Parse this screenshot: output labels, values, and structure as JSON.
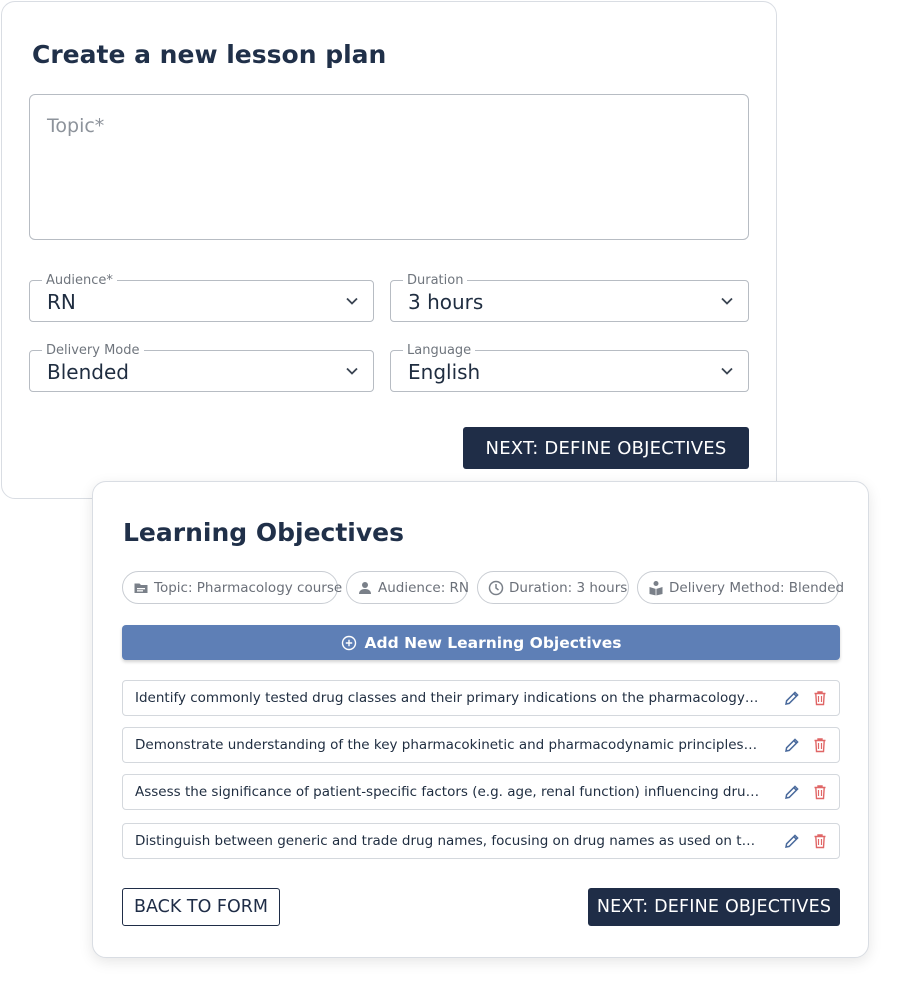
{
  "form": {
    "title": "Create a new lesson plan",
    "topic_placeholder": "Topic*",
    "topic_value": "",
    "audience": {
      "label": "Audience*",
      "value": "RN"
    },
    "duration": {
      "label": "Duration",
      "value": "3 hours"
    },
    "delivery_mode": {
      "label": "Delivery Mode",
      "value": "Blended"
    },
    "language": {
      "label": "Language",
      "value": "English"
    },
    "next_label": "NEXT: DEFINE OBJECTIVES"
  },
  "objectives": {
    "title": "Learning Objectives",
    "chips": {
      "topic": "Topic: Pharmacology course",
      "audience": "Audience: RN",
      "duration": "Duration: 3 hours",
      "delivery": "Delivery Method: Blended"
    },
    "add_label": "Add New Learning Objectives",
    "items": [
      "Identify commonly tested drug classes and their primary indications on the pharmacology section.",
      "Demonstrate understanding of the key pharmacokinetic and pharmacodynamic principles critical...",
      "Assess the significance of patient-specific factors (e.g. age, renal function) influencing drug therapy...",
      "Distinguish between generic and trade drug names, focusing on drug names as used on the ..."
    ],
    "back_label": "BACK TO FORM",
    "next_label": "NEXT: DEFINE OBJECTIVES"
  },
  "colors": {
    "primary_dark": "#1f2d47",
    "accent_blue": "#5e7fb6",
    "edit_icon": "#4a6a9c",
    "delete_icon": "#e06666"
  },
  "icons": {
    "chip_topic": "folder-icon",
    "chip_audience": "person-icon",
    "chip_duration": "clock-icon",
    "chip_delivery": "book-reader-icon",
    "add": "plus-circle-icon",
    "edit": "pencil-icon",
    "delete": "trash-icon"
  }
}
